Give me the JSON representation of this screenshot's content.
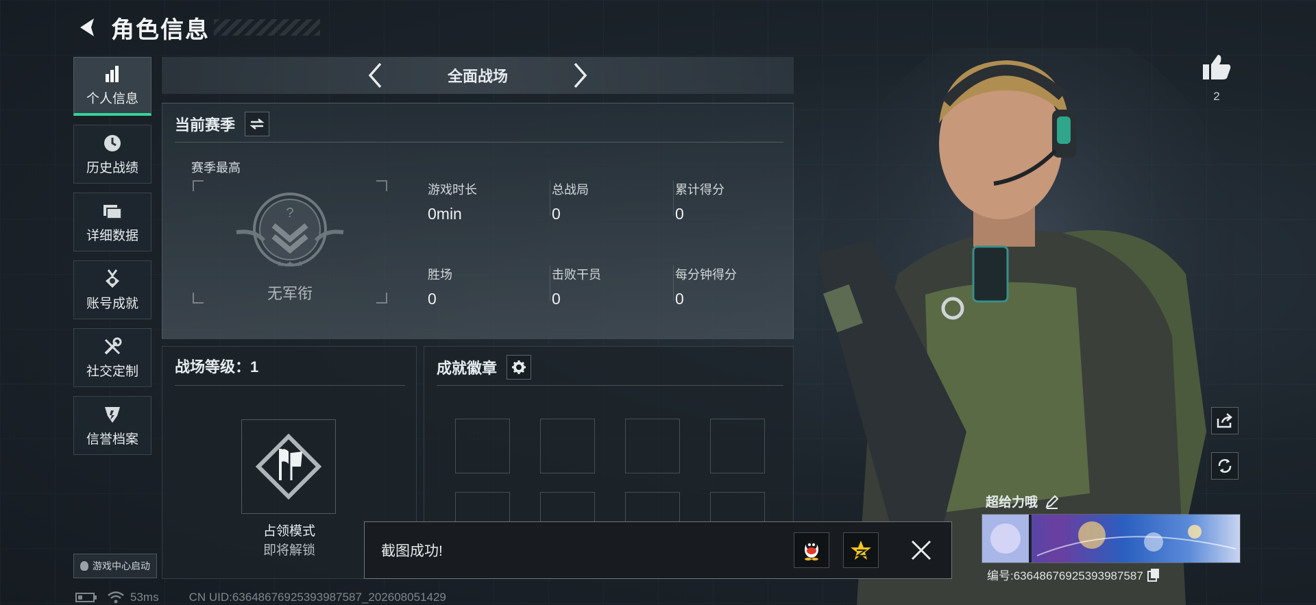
{
  "header": {
    "title": "角色信息"
  },
  "nav": {
    "items": [
      {
        "label": "个人信息",
        "icon": "bar-chart-icon",
        "active": true
      },
      {
        "label": "历史战绩",
        "icon": "clock-icon"
      },
      {
        "label": "详细数据",
        "icon": "folder-icon"
      },
      {
        "label": "账号成就",
        "icon": "medal-icon"
      },
      {
        "label": "社交定制",
        "icon": "tools-icon"
      },
      {
        "label": "信誉档案",
        "icon": "shield-icon"
      }
    ],
    "game_center": "游戏中心启动"
  },
  "mode_bar": {
    "title": "全面战场"
  },
  "season": {
    "title": "当前赛季",
    "best_label": "赛季最高",
    "rank": "无军衔",
    "stats": [
      {
        "label": "游戏时长",
        "value": "0min"
      },
      {
        "label": "总战局",
        "value": "0"
      },
      {
        "label": "累计得分",
        "value": "0"
      },
      {
        "label": "胜场",
        "value": "0"
      },
      {
        "label": "击败干员",
        "value": "0"
      },
      {
        "label": "每分钟得分",
        "value": "0"
      }
    ]
  },
  "level": {
    "title": "战场等级：1",
    "mode_name": "占领模式",
    "mode_status": "即将解锁"
  },
  "badges": {
    "title": "成就徽章"
  },
  "toast": {
    "text": "截图成功!"
  },
  "profile": {
    "likes": "2",
    "name": "超给力哦",
    "id_text": "编号:6364867692539398758​7"
  },
  "status": {
    "ping": "53ms",
    "uid": "CN UID:6364867692539398758​7_202608051429"
  },
  "colors": {
    "accent": "#35d39a",
    "background": "#1a2128"
  }
}
